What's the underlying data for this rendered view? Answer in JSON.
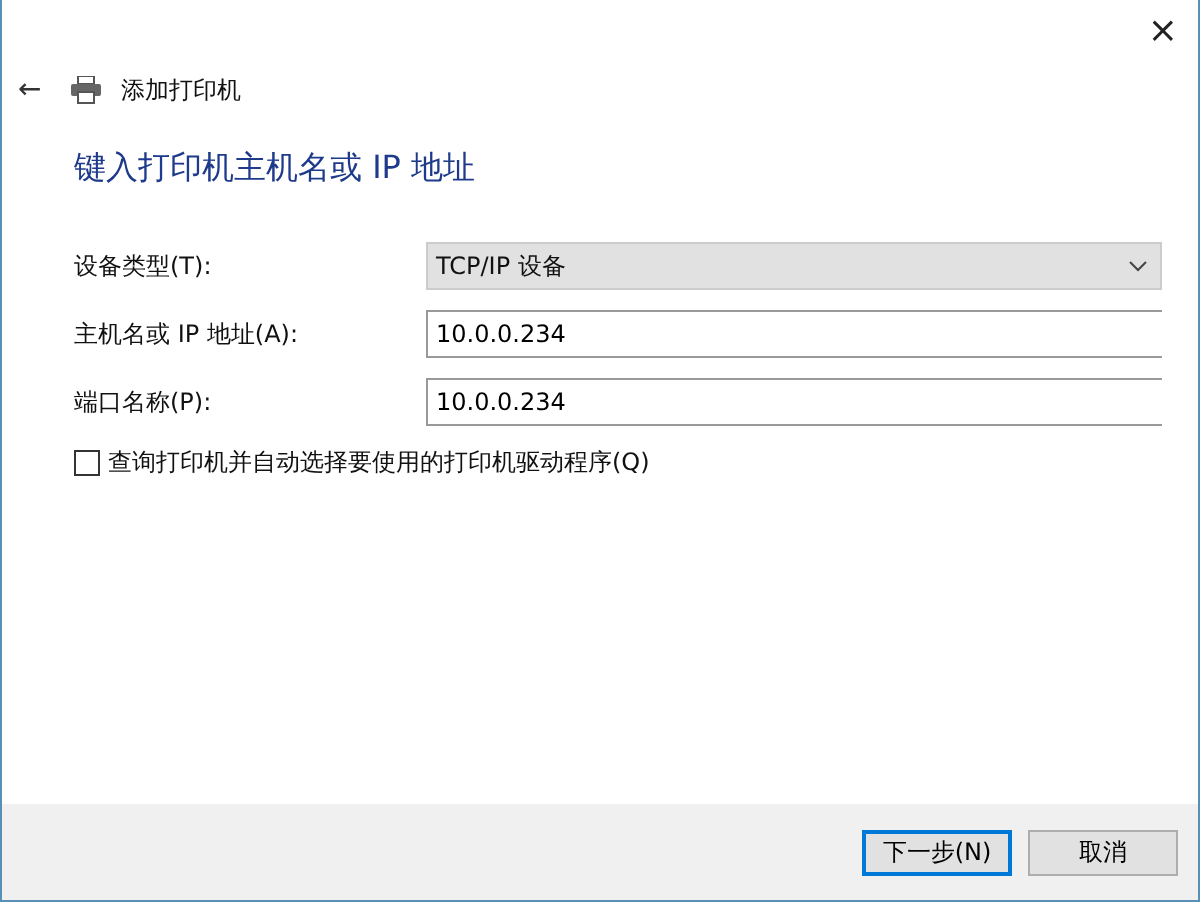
{
  "window": {
    "close": "×"
  },
  "header": {
    "back": "←",
    "title": "添加打印机"
  },
  "heading": "键入打印机主机名或 IP 地址",
  "fields": [
    {
      "kind": "dropdown",
      "label": "设备类型(T):",
      "value": "TCP/IP 设备"
    },
    {
      "kind": "text",
      "label": "主机名或 IP 地址(A):",
      "value": "10.0.0.234"
    },
    {
      "kind": "text",
      "label": "端口名称(P):",
      "value": "10.0.0.234"
    }
  ],
  "checkbox": {
    "label": "查询打印机并自动选择要使用的打印机驱动程序(Q)",
    "checked": false
  },
  "buttons": [
    {
      "label": "下一步(N)",
      "selected": true
    },
    {
      "label": "取消",
      "selected": false
    }
  ]
}
